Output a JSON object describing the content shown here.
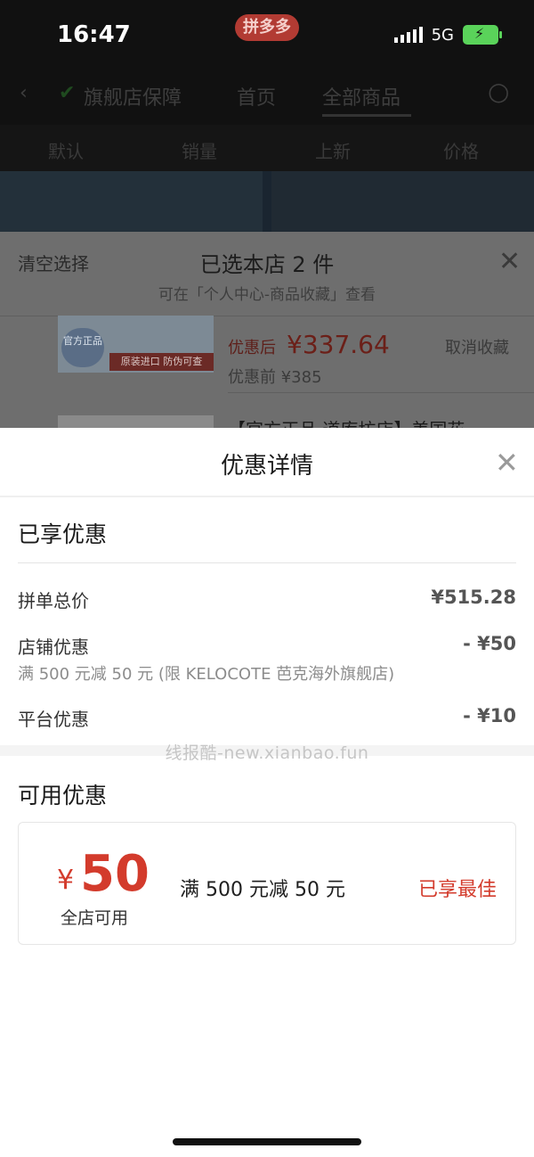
{
  "status_bar": {
    "time": "16:47",
    "network": "5G",
    "app_badge": "拼多多"
  },
  "nav": {
    "tabs": [
      "旗舰店保障",
      "首页",
      "全部商品"
    ],
    "active_tab": "全部商品"
  },
  "subnav": {
    "items": [
      "默认",
      "销量",
      "上新",
      "价格"
    ]
  },
  "selection_sheet": {
    "clear_label": "清空选择",
    "title": "已选本店 2 件",
    "subtitle": "可在「个人中心-商品收藏」查看",
    "product": {
      "image_badge": "官方正品",
      "image_caption": "原装进口 防伪可查",
      "price_label": "优惠后",
      "price": "¥337.64",
      "original_price": "优惠前 ¥385",
      "action": "取消收藏"
    },
    "next_item_text": "【官方正品 道库坊店】美国花"
  },
  "detail_sheet": {
    "title": "优惠详情",
    "enjoyed": {
      "heading": "已享优惠",
      "rows": [
        {
          "label": "拼单总价",
          "value": "¥515.28"
        },
        {
          "label": "店铺优惠",
          "value": "- ¥50",
          "note": "满 500 元减 50 元 (限 KELOCOTE 芭克海外旗舰店)"
        },
        {
          "label": "平台优惠",
          "value": "- ¥10"
        }
      ]
    },
    "watermark": "线报酷-new.xianbao.fun",
    "available": {
      "heading": "可用优惠",
      "coupon": {
        "currency": "¥",
        "amount": "50",
        "scope": "全店可用",
        "rule": "满 500 元减 50 元",
        "status": "已享最佳"
      }
    }
  },
  "colors": {
    "accent_red": "#d33b2c",
    "overlay": "#6e6e6e",
    "background": "#ffffff"
  }
}
